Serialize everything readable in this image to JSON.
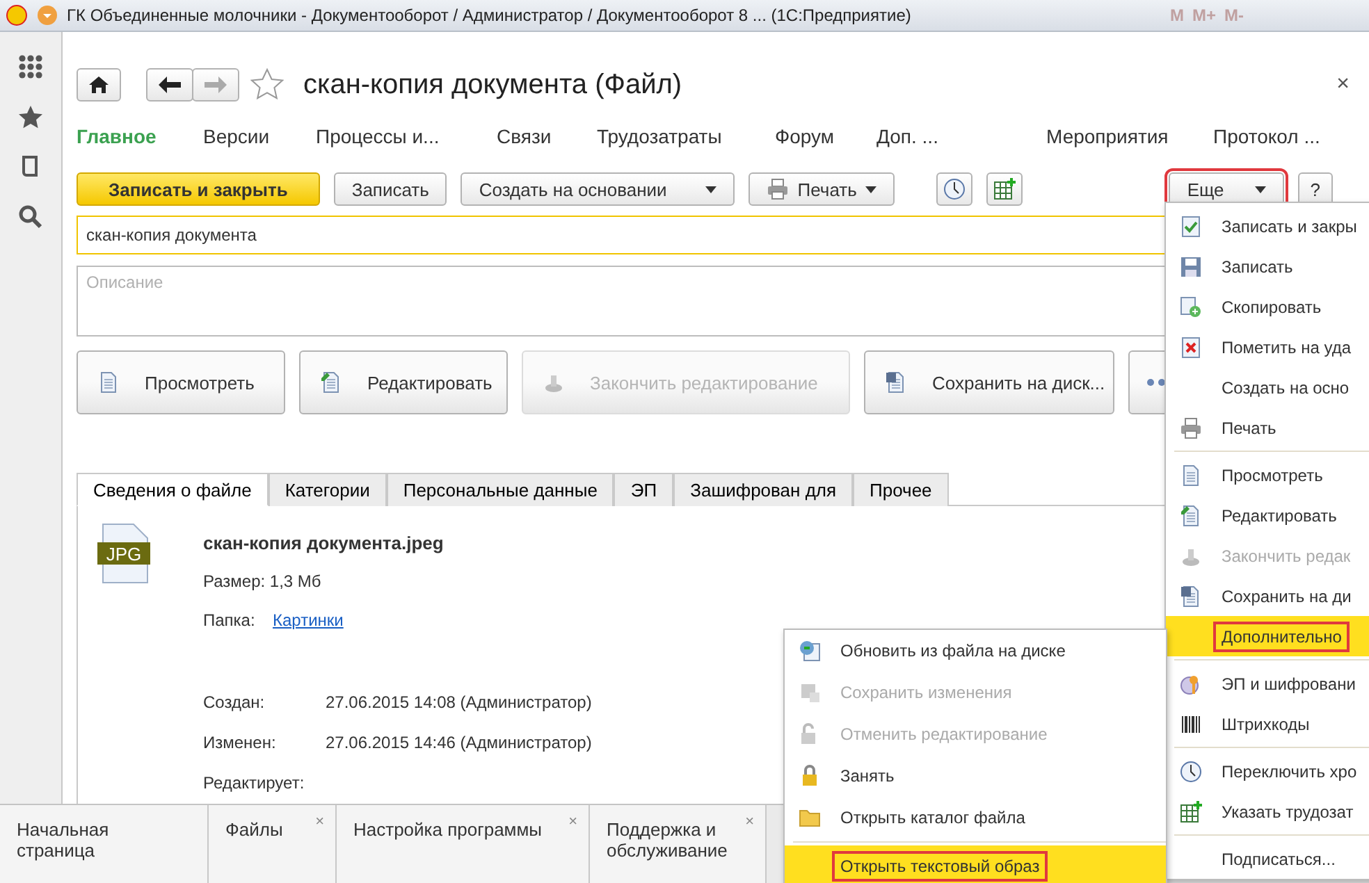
{
  "window": {
    "title": "ГК Объединенные молочники - Документооборот / Администратор / Документооборот 8 ...  (1С:Предприятие)",
    "memory_keys": [
      "M",
      "M+",
      "M-"
    ]
  },
  "form": {
    "title": "скан-копия документа (Файл)",
    "close": "×",
    "nav_tabs": [
      {
        "label": "Главное",
        "selected": true
      },
      {
        "label": "Версии",
        "selected": false
      },
      {
        "label": "Процессы и...",
        "selected": false
      },
      {
        "label": "Связи",
        "selected": false
      },
      {
        "label": "Трудозатраты",
        "selected": false
      },
      {
        "label": "Форум",
        "selected": false
      },
      {
        "label": "Доп. ...",
        "selected": false
      },
      {
        "label": "Мероприятия",
        "selected": false
      },
      {
        "label": "Протокол ...",
        "selected": false
      }
    ],
    "commands": [
      {
        "kind": "primary",
        "label": "Записать и закрыть"
      },
      {
        "kind": "plain",
        "label": "Записать"
      },
      {
        "kind": "dropdown",
        "label": "Создать на основании"
      },
      {
        "kind": "print",
        "label": "Печать"
      },
      {
        "kind": "clock"
      },
      {
        "kind": "labor"
      }
    ],
    "more_button": {
      "label": "Еще",
      "marked": true
    },
    "help_button": "?",
    "name_value": "скан-копия документа",
    "description_placeholder": "Описание",
    "actions": [
      {
        "label": "Просмотреть",
        "disabled": false
      },
      {
        "label": "Редактировать",
        "disabled": false
      },
      {
        "label": "Закончить редактирование",
        "disabled": true
      },
      {
        "label": "Сохранить на диск...",
        "disabled": false
      }
    ],
    "info_tabs": [
      {
        "label": "Сведения о файле",
        "selected": true
      },
      {
        "label": "Категории",
        "selected": false
      },
      {
        "label": "Персональные данные",
        "selected": false
      },
      {
        "label": "ЭП",
        "selected": false
      },
      {
        "label": "Зашифрован для",
        "selected": false
      },
      {
        "label": "Прочее",
        "selected": false
      }
    ],
    "file": {
      "badge": "JPG",
      "name": "скан-копия документа.jpeg",
      "size": "Размер: 1,3 Мб",
      "folder_label": "Папка:",
      "folder_link": "Картинки",
      "created_label": "Создан:",
      "created": "27.06.2015 14:08 (Администратор)",
      "changed_label": "Изменен:",
      "changed": "27.06.2015 14:46 (Администратор)",
      "editor_label": "Редактирует:"
    }
  },
  "more_menu": [
    [
      {
        "label": "Записать и закры",
        "disabled": false,
        "selected": false,
        "marked": false
      },
      {
        "label": "Записать",
        "disabled": false,
        "selected": false,
        "marked": false
      },
      {
        "label": "Скопировать",
        "disabled": false,
        "selected": false,
        "marked": false
      },
      {
        "label": "Пометить на уда",
        "disabled": false,
        "selected": false,
        "marked": false
      },
      {
        "label": "Создать на осно",
        "disabled": false,
        "selected": false,
        "marked": false
      },
      {
        "label": "Печать",
        "disabled": false,
        "selected": false,
        "marked": false
      }
    ],
    [
      {
        "label": "Просмотреть",
        "disabled": false,
        "selected": false,
        "marked": false
      },
      {
        "label": "Редактировать",
        "disabled": false,
        "selected": false,
        "marked": false
      },
      {
        "label": "Закончить редак",
        "disabled": true,
        "selected": false,
        "marked": false
      },
      {
        "label": "Сохранить на ди",
        "disabled": false,
        "selected": false,
        "marked": false
      },
      {
        "label": "Дополнительно",
        "disabled": false,
        "selected": true,
        "marked": true
      }
    ],
    [
      {
        "label": "ЭП и шифровани",
        "disabled": false,
        "selected": false,
        "marked": false
      },
      {
        "label": "Штрихкоды",
        "disabled": false,
        "selected": false,
        "marked": false
      }
    ],
    [
      {
        "label": "Переключить хро",
        "disabled": false,
        "selected": false,
        "marked": false
      },
      {
        "label": "Указать трудозат",
        "disabled": false,
        "selected": false,
        "marked": false
      }
    ],
    [
      {
        "label": "Подписаться...",
        "disabled": false,
        "selected": false,
        "marked": false
      }
    ]
  ],
  "sub_menu": [
    {
      "label": "Обновить из файла на диске",
      "disabled": false,
      "selected": false,
      "marked": false
    },
    {
      "label": "Сохранить изменения",
      "disabled": true,
      "selected": false,
      "marked": false
    },
    {
      "label": "Отменить редактирование",
      "disabled": true,
      "selected": false,
      "marked": false
    },
    {
      "label": "Занять",
      "disabled": false,
      "selected": false,
      "marked": false
    },
    {
      "label": "Открыть каталог файла",
      "disabled": false,
      "selected": false,
      "marked": false
    },
    {
      "label": "Открыть текстовый образ",
      "disabled": false,
      "selected": true,
      "marked": true
    }
  ],
  "tab_close": "×",
  "bottom_tabs": [
    {
      "label": "Начальная страница",
      "closable": false
    },
    {
      "label": "Файлы",
      "closable": true
    },
    {
      "label": "Настройка программы",
      "closable": true
    },
    {
      "label": "Поддержка и обслуживание",
      "closable": true
    }
  ]
}
